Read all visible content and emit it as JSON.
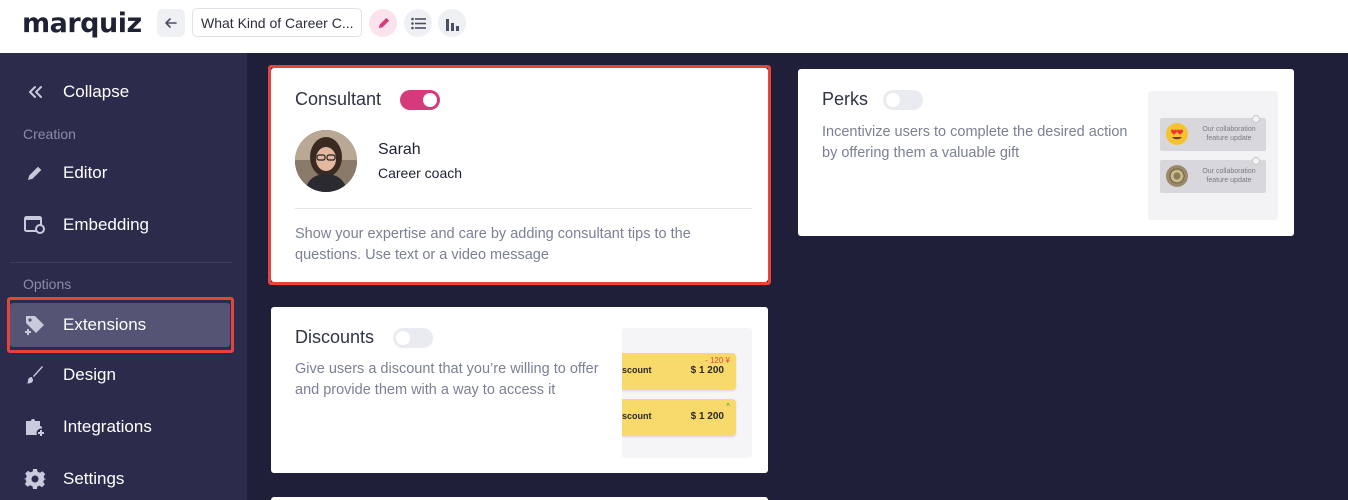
{
  "app": {
    "logo": "marquiz"
  },
  "header": {
    "back_icon": "arrow-left-icon",
    "quiz_title": "What Kind of Career C...",
    "tools": [
      "pencil-icon",
      "list-icon",
      "bar-chart-icon"
    ],
    "accent_color": "#d6397c"
  },
  "sidebar": {
    "collapse_label": "Collapse",
    "sections": [
      {
        "title": "Creation",
        "items": [
          {
            "label": "Editor",
            "icon": "pencil-icon"
          },
          {
            "label": "Embedding",
            "icon": "embed-gear-icon"
          }
        ]
      },
      {
        "title": "Options",
        "items": [
          {
            "label": "Extensions",
            "icon": "tag-plus-icon",
            "active": true
          },
          {
            "label": "Design",
            "icon": "brush-icon"
          },
          {
            "label": "Integrations",
            "icon": "puzzle-plus-icon"
          },
          {
            "label": "Settings",
            "icon": "gear-icon"
          }
        ]
      }
    ]
  },
  "cards": {
    "consultant": {
      "title": "Consultant",
      "enabled": true,
      "name": "Sarah",
      "role": "Career coach",
      "description": "Show your expertise and care by adding consultant tips to the questions. Use text or a video message"
    },
    "discounts": {
      "title": "Discounts",
      "enabled": false,
      "description": "Give users a discount that you’re willing to offer and provide them with a way to access it",
      "preview": {
        "coupons": [
          {
            "label": "scount",
            "price": "$ 1 200",
            "tag": "- 120 ¥"
          },
          {
            "label": "scount",
            "price": "$ 1 200",
            "tag": "^"
          }
        ]
      }
    },
    "perks": {
      "title": "Perks",
      "enabled": false,
      "description": "Incentivize users to complete the desired action by offering them a valuable gift",
      "preview": {
        "items": [
          {
            "text": "Our collaboration feature update",
            "icon": "heart-eyes-emoji-icon"
          },
          {
            "text": "Our collaboration feature update",
            "icon": "coin-icon"
          }
        ]
      }
    }
  },
  "colors": {
    "sidebar_bg": "#2b2b4b",
    "main_bg": "#1f1f3a",
    "highlight": "#e8423b",
    "coupon": "#f8d96b"
  }
}
